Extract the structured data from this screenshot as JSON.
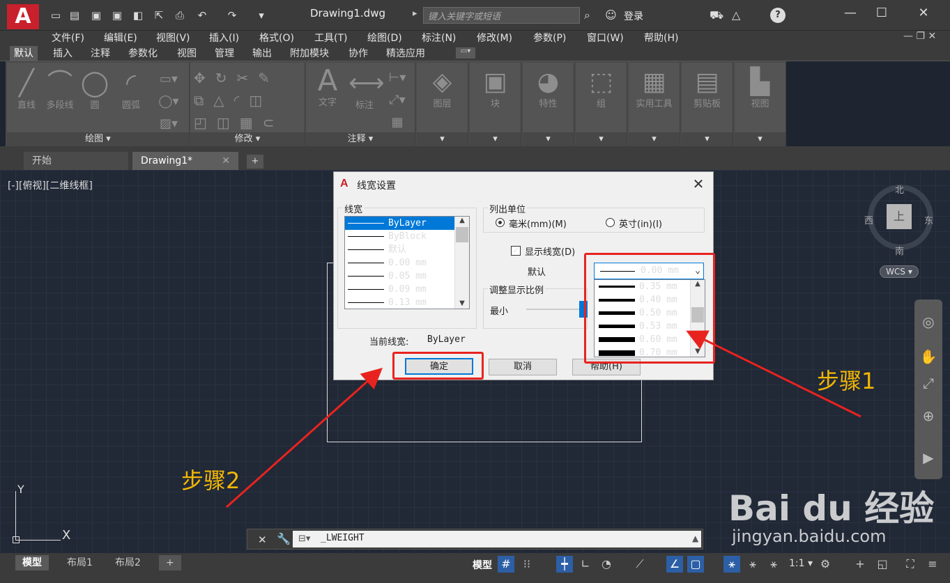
{
  "titlebar": {
    "logo": "A",
    "doc_title": "Drawing1.dwg",
    "search_placeholder": "键入关键字或短语",
    "login": "登录",
    "help": "?"
  },
  "menu": [
    "文件(F)",
    "编辑(E)",
    "视图(V)",
    "插入(I)",
    "格式(O)",
    "工具(T)",
    "绘图(D)",
    "标注(N)",
    "修改(M)",
    "参数(P)",
    "窗口(W)",
    "帮助(H)"
  ],
  "ribbon_tabs": [
    "默认",
    "插入",
    "注释",
    "参数化",
    "视图",
    "管理",
    "输出",
    "附加模块",
    "协作",
    "精选应用"
  ],
  "ribbon": {
    "draw_tools": [
      "直线",
      "多段线",
      "圆",
      "圆弧"
    ],
    "panels": [
      "绘图",
      "修改",
      "注释"
    ],
    "annot_tools": [
      "文字",
      "标注"
    ],
    "groups": [
      "图层",
      "块",
      "特性",
      "组",
      "实用工具",
      "剪贴板",
      "视图"
    ]
  },
  "doc_tabs": {
    "start": "开始",
    "drawing": "Drawing1*",
    "add": "+"
  },
  "viewport_label": "[-][俯视][二维线框]",
  "compass": {
    "north": "北",
    "south": "南",
    "east": "东",
    "west": "西",
    "top": "上",
    "wcs": "WCS"
  },
  "dialog": {
    "title": "线宽设置",
    "lw_group": "线宽",
    "lw_items": [
      "ByLayer",
      "ByBlock",
      "默认",
      "0.00 mm",
      "0.05 mm",
      "0.09 mm",
      "0.13 mm"
    ],
    "units_group": "列出单位",
    "unit_mm": "毫米(mm)(M)",
    "unit_in": "英寸(in)(I)",
    "show_lw": "显示线宽(D)",
    "default_label": "默认",
    "default_value": "0.00 mm",
    "scale_group": "调整显示比例",
    "scale_min": "最小",
    "current_label": "当前线宽:",
    "current_value": "ByLayer",
    "ok": "确定",
    "cancel": "取消",
    "help": "帮助(H)",
    "dropdown": [
      "0.35 mm",
      "0.40 mm",
      "0.50 mm",
      "0.53 mm",
      "0.60 mm",
      "0.70 mm"
    ]
  },
  "annotations": {
    "step1": "步骤1",
    "step2": "步骤2"
  },
  "command": {
    "text": "_LWEIGHT"
  },
  "layout_tabs": [
    "模型",
    "布局1",
    "布局2",
    "+"
  ],
  "status": {
    "model": "模型",
    "scale": "1:1"
  },
  "watermark": {
    "main": "Bai du 经验",
    "sub": "jingyan.baidu.com"
  },
  "axes": {
    "y": "Y",
    "x": "X"
  }
}
